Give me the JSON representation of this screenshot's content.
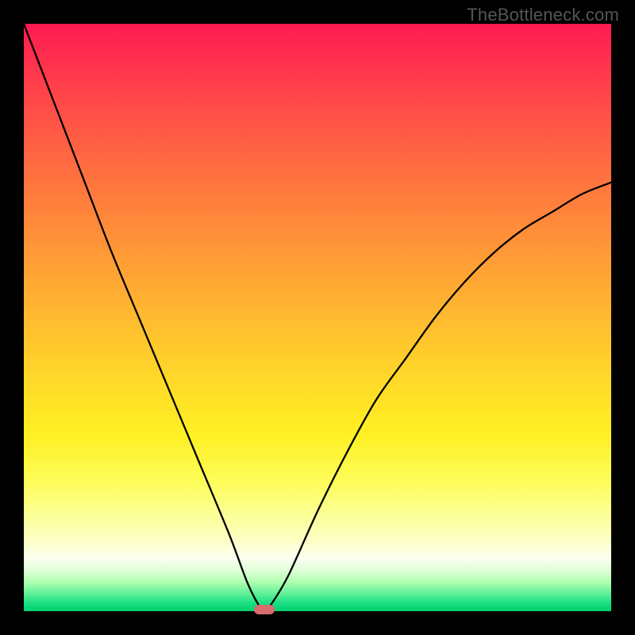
{
  "watermark": "TheBottleneck.com",
  "chart_data": {
    "type": "line",
    "title": "",
    "xlabel": "",
    "ylabel": "",
    "xlim": [
      0,
      100
    ],
    "ylim": [
      0,
      100
    ],
    "x": [
      0,
      5,
      10,
      15,
      20,
      25,
      30,
      35,
      38,
      40,
      41,
      42,
      45,
      50,
      55,
      60,
      65,
      70,
      75,
      80,
      85,
      90,
      95,
      100
    ],
    "values": [
      100,
      87,
      74,
      61,
      49,
      37,
      25,
      13,
      5,
      1,
      0,
      1,
      6,
      17,
      27,
      36,
      43,
      50,
      56,
      61,
      65,
      68,
      71,
      73
    ],
    "minimum_x": 41,
    "marker": {
      "x": 41,
      "y": 0,
      "color": "#d76d6d"
    },
    "gradient_stops": [
      {
        "pos": 0.0,
        "color": "#ff1a52"
      },
      {
        "pos": 0.5,
        "color": "#ffd22a"
      },
      {
        "pos": 0.9,
        "color": "#fcffc5"
      },
      {
        "pos": 1.0,
        "color": "#00d070"
      }
    ]
  }
}
